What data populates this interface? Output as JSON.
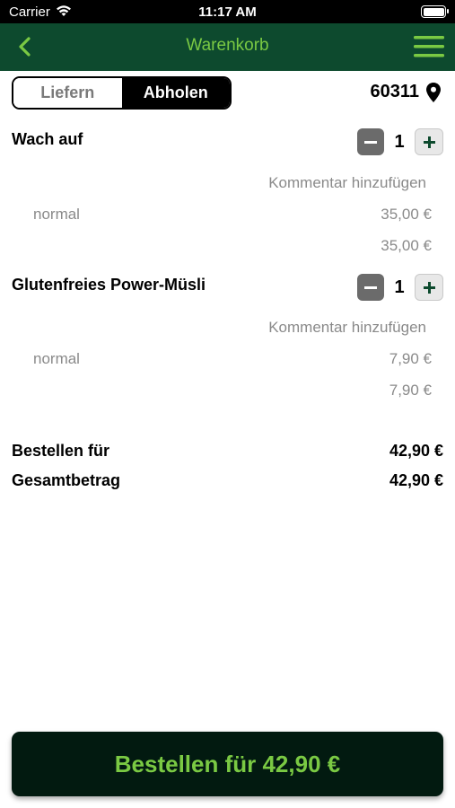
{
  "status_bar": {
    "carrier": "Carrier",
    "time": "11:17 AM"
  },
  "nav": {
    "title": "Warenkorb",
    "back_icon": "chevron-left-icon",
    "menu_icon": "hamburger-menu-icon"
  },
  "colors": {
    "brand_green": "#0d4a2e",
    "accent_green": "#7ac943",
    "button_dark": "#021a10"
  },
  "delivery_toggle": {
    "options": [
      "Liefern",
      "Abholen"
    ],
    "selected": "Abholen"
  },
  "location": {
    "zip": "60311",
    "icon": "location-pin-icon"
  },
  "cart_items": [
    {
      "name": "Wach auf",
      "quantity": "1",
      "comment_label": "Kommentar hinzufügen",
      "variant": "normal",
      "variant_price": "35,00 €",
      "line_total": "35,00 €"
    },
    {
      "name": "Glutenfreies Power-Müsli",
      "quantity": "1",
      "comment_label": "Kommentar hinzufügen",
      "variant": "normal",
      "variant_price": "7,90 €",
      "line_total": "7,90 €"
    }
  ],
  "summary": {
    "order_for_label": "Bestellen für",
    "order_for_value": "42,90 €",
    "total_label": "Gesamtbetrag",
    "total_value": "42,90 €"
  },
  "order_button": {
    "label": "Bestellen für 42,90 €"
  }
}
